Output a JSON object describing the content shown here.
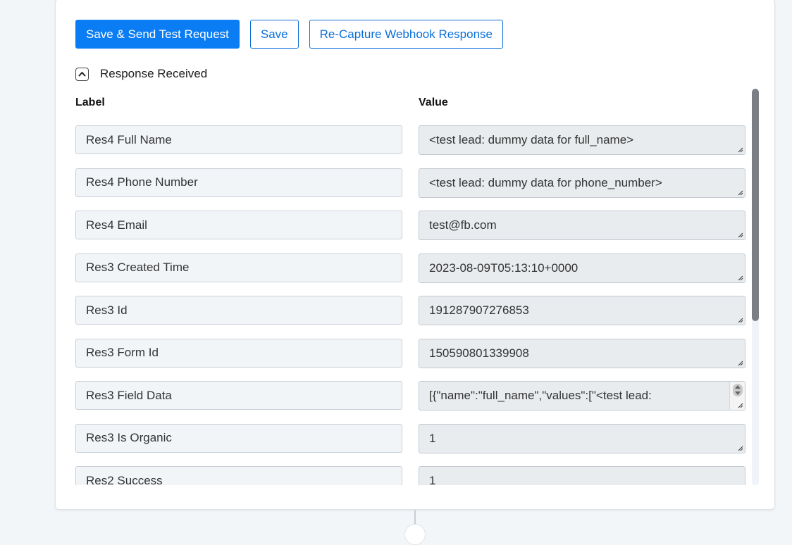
{
  "toolbar": {
    "save_send_label": "Save & Send Test Request",
    "save_label": "Save",
    "recapture_label": "Re-Capture Webhook Response"
  },
  "section": {
    "title": "Response Received",
    "collapsed": false
  },
  "columns": {
    "label": "Label",
    "value": "Value"
  },
  "rows": [
    {
      "label": "Res4 Full Name",
      "value": "<test lead: dummy data for full_name>"
    },
    {
      "label": "Res4 Phone Number",
      "value": "<test lead: dummy data for phone_number>"
    },
    {
      "label": "Res4 Email",
      "value": "test@fb.com"
    },
    {
      "label": "Res3 Created Time",
      "value": "2023-08-09T05:13:10+0000"
    },
    {
      "label": "Res3 Id",
      "value": "191287907276853"
    },
    {
      "label": "Res3 Form Id",
      "value": "150590801339908"
    },
    {
      "label": "Res3 Field Data",
      "value": "[{\"name\":\"full_name\",\"values\":[\"<test lead:"
    },
    {
      "label": "Res3 Is Organic",
      "value": "1"
    },
    {
      "label": "Res2 Success",
      "value": "1"
    }
  ],
  "colors": {
    "primary": "#0a7cf4",
    "outline": "#0a6fd8",
    "label_bg": "#f2f5f8",
    "value_bg": "#e9ecef",
    "scrollbar": "#7b7f85"
  },
  "icons": {
    "collapse": "chevron-up-icon",
    "resize": "resize-grip-icon"
  }
}
